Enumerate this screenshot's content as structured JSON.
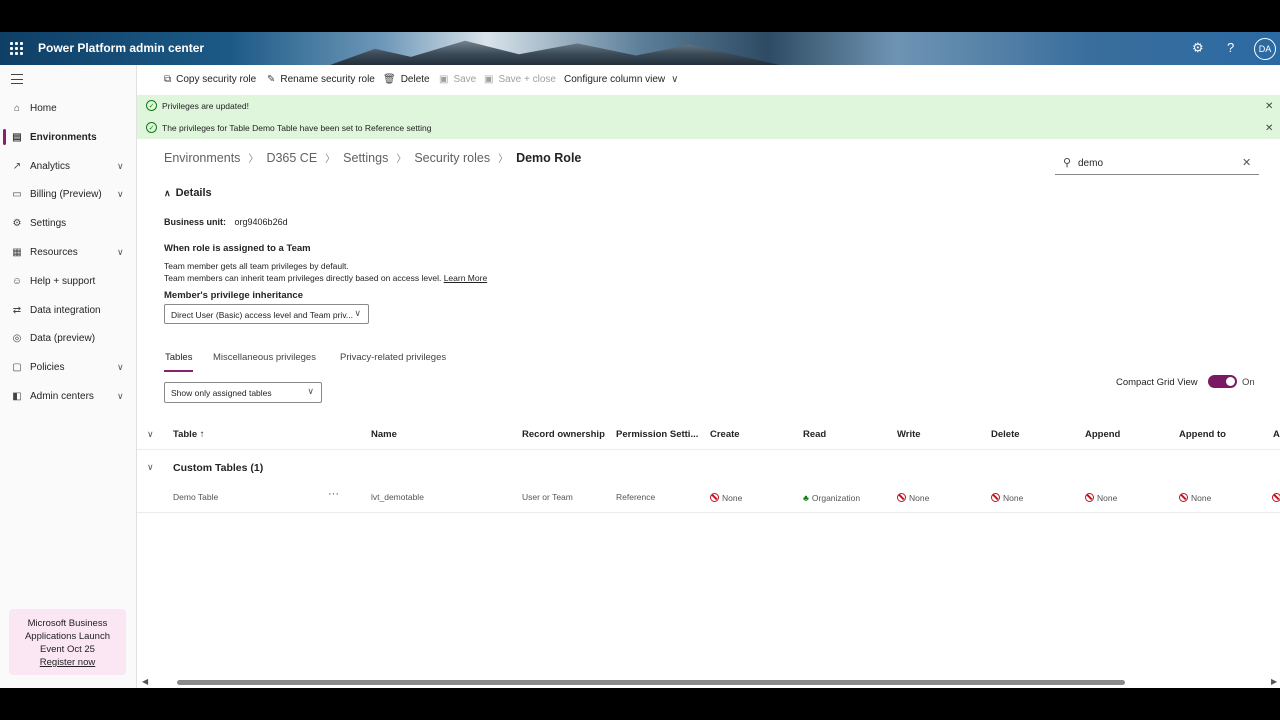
{
  "app": {
    "title": "Power Platform admin center",
    "avatar": "DA",
    "accent": "#8a1f6e"
  },
  "sidebar": {
    "items": [
      {
        "label": "Home",
        "icon": "home-icon",
        "expandable": false
      },
      {
        "label": "Environments",
        "icon": "environments-icon",
        "expandable": false,
        "selected": true
      },
      {
        "label": "Analytics",
        "icon": "analytics-icon",
        "expandable": true
      },
      {
        "label": "Billing (Preview)",
        "icon": "billing-icon",
        "expandable": true
      },
      {
        "label": "Settings",
        "icon": "gear-icon",
        "expandable": false
      },
      {
        "label": "Resources",
        "icon": "resources-icon",
        "expandable": true
      },
      {
        "label": "Help + support",
        "icon": "help-icon",
        "expandable": false
      },
      {
        "label": "Data integration",
        "icon": "data-integration-icon",
        "expandable": false
      },
      {
        "label": "Data (preview)",
        "icon": "data-icon",
        "expandable": false
      },
      {
        "label": "Policies",
        "icon": "policies-icon",
        "expandable": true
      },
      {
        "label": "Admin centers",
        "icon": "admin-centers-icon",
        "expandable": true
      }
    ],
    "promo": {
      "line1": "Microsoft Business",
      "line2": "Applications Launch",
      "line3": "Event Oct 25",
      "link": "Register now"
    }
  },
  "toolbar": {
    "copy": "Copy security role",
    "rename": "Rename security role",
    "delete": "Delete",
    "save": "Save",
    "save_close": "Save + close",
    "configure": "Configure column view"
  },
  "notifications": [
    {
      "text": "Privileges are updated!"
    },
    {
      "text": "The privileges for Table Demo Table have been set to Reference setting"
    }
  ],
  "breadcrumb": [
    "Environments",
    "D365 CE",
    "Settings",
    "Security roles",
    "Demo Role"
  ],
  "search": {
    "value": "demo"
  },
  "details": {
    "heading": "Details",
    "business_unit_label": "Business unit:",
    "business_unit_value": "org9406b26d",
    "team_heading": "When role is assigned to a Team",
    "team_line1": "Team member gets all team privileges by default.",
    "team_line2": "Team members can inherit team privileges directly based on access level.",
    "learn_more": "Learn More",
    "inheritance_label": "Member's privilege inheritance",
    "inheritance_value": "Direct User (Basic) access level and Team priv..."
  },
  "tabs": [
    "Tables",
    "Miscellaneous privileges",
    "Privacy-related privileges"
  ],
  "filter": {
    "value": "Show only assigned tables"
  },
  "compact": {
    "label": "Compact Grid View",
    "state": "On"
  },
  "grid": {
    "columns": [
      "Table ↑",
      "Name",
      "Record ownership",
      "Permission Setti...",
      "Create",
      "Read",
      "Write",
      "Delete",
      "Append",
      "Append to",
      "As"
    ],
    "group": "Custom Tables (1)",
    "row": {
      "table": "Demo Table",
      "more": "···",
      "name": "lvt_demotable",
      "ownership": "User or Team",
      "permission": "Reference",
      "create": "None",
      "read": "Organization",
      "write": "None",
      "delete": "None",
      "append": "None",
      "append_to": "None"
    }
  }
}
